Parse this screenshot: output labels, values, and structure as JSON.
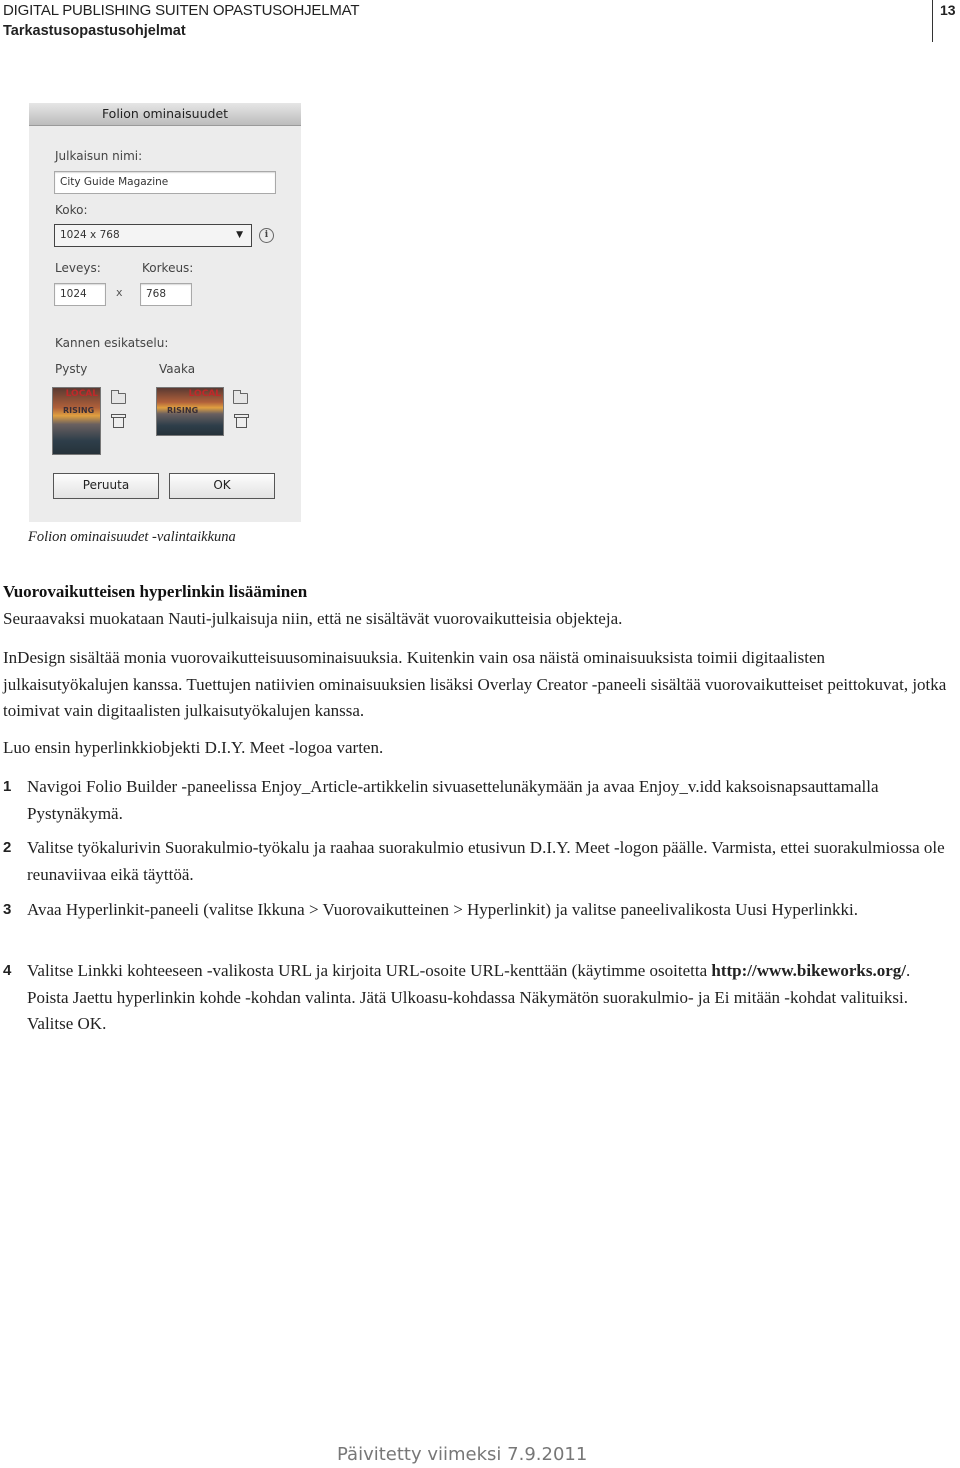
{
  "header": {
    "title": "DIGITAL PUBLISHING SUITEN OPASTUSOHJELMAT",
    "subtitle": "Tarkastusopastusohjelmat",
    "page_number": "13"
  },
  "dialog": {
    "title": "Folion ominaisuudet",
    "publication_name_label": "Julkaisun nimi:",
    "publication_name_value": "City Guide Magazine",
    "size_label": "Koko:",
    "size_value": "1024 x 768",
    "size_arrow": "▼",
    "info_glyph": "i",
    "width_label": "Leveys:",
    "width_value": "1024",
    "times": "x",
    "height_label": "Korkeus:",
    "height_value": "768",
    "preview_label": "Kannen esikatselu:",
    "portrait_label": "Pysty",
    "landscape_label": "Vaaka",
    "thumb_title": "LOCAL",
    "thumb_subtitle": "RISING",
    "cancel_label": "Peruuta",
    "ok_label": "OK"
  },
  "caption": "Folion ominaisuudet -valintaikkuna",
  "section_title": "Vuorovaikutteisen hyperlinkin lisääminen",
  "paragraphs": [
    "Seuraavaksi muokataan Nauti-julkaisuja niin, että ne sisältävät vuorovaikutteisia objekteja.",
    "InDesign sisältää monia vuorovaikutteisuusominaisuuksia. Kuitenkin vain osa näistä ominaisuuksista toimii digitaalisten julkaisutyökalujen kanssa. Tuettujen natiivien ominaisuuksien lisäksi Overlay Creator -paneeli sisältää vuorovaikutteiset peittokuvat, jotka toimivat vain digitaalisten julkaisutyökalujen kanssa.",
    "Luo ensin hyperlinkkiobjekti D.I.Y. Meet -logoa varten."
  ],
  "steps": [
    {
      "num": "1",
      "text": "Navigoi Folio Builder -paneelissa Enjoy_Article-artikkelin sivuasettelunäkymään ja avaa Enjoy_v.idd kaksoisnapsauttamalla Pystynäkymä."
    },
    {
      "num": "2",
      "text": "Valitse työkalurivin Suorakulmio-työkalu ja raahaa suorakulmio etusivun D.I.Y. Meet -logon päälle. Varmista, ettei suorakulmiossa ole reunaviivaa eikä täyttöä."
    },
    {
      "num": "3",
      "text": "Avaa Hyperlinkit-paneeli (valitse Ikkuna > Vuorovaikutteinen > Hyperlinkit) ja valitse paneelivalikosta Uusi Hyperlinkki."
    },
    {
      "num": "4",
      "text_before": "Valitse Linkki kohteeseen -valikosta URL ja kirjoita URL-osoite URL-kenttään (käytimme osoitetta ",
      "url": "http://www.bikeworks.org/",
      "text_after": ". Poista Jaettu hyperlinkin kohde -kohdan valinta. Jätä Ulkoasu-kohdassa Näkymätön suorakulmio- ja Ei mitään -kohdat valituiksi. Valitse OK."
    }
  ],
  "footer": "Päivitetty viimeksi 7.9.2011"
}
